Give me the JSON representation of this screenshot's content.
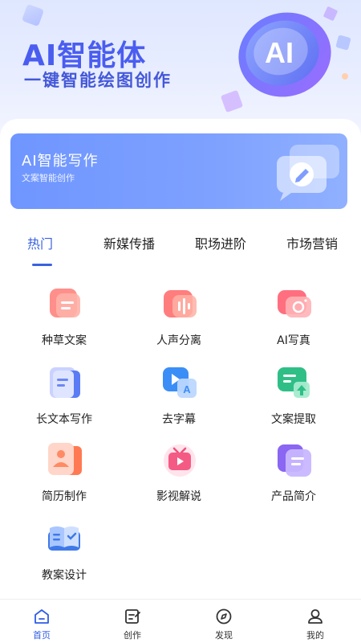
{
  "hero": {
    "title": "AI智能体",
    "subtitle": "一键智能绘图创作",
    "logo_text": "AI"
  },
  "banner": {
    "title": "AI智能写作",
    "subtitle": "文案智能创作",
    "icon": "edit-chat-bubble-icon"
  },
  "tabs": [
    {
      "label": "热门",
      "active": true
    },
    {
      "label": "新媒传播",
      "active": false
    },
    {
      "label": "职场进阶",
      "active": false
    },
    {
      "label": "市场营销",
      "active": false
    }
  ],
  "tools": [
    {
      "label": "种草文案",
      "icon": "note-card-icon"
    },
    {
      "label": "人声分离",
      "icon": "audio-wave-icon"
    },
    {
      "label": "AI写真",
      "icon": "camera-icon"
    },
    {
      "label": "长文本写作",
      "icon": "long-document-icon"
    },
    {
      "label": "去字幕",
      "icon": "subtitle-remove-icon"
    },
    {
      "label": "文案提取",
      "icon": "text-extract-icon"
    },
    {
      "label": "简历制作",
      "icon": "resume-icon"
    },
    {
      "label": "影视解说",
      "icon": "tv-play-icon"
    },
    {
      "label": "产品简介",
      "icon": "product-doc-icon"
    },
    {
      "label": "教案设计",
      "icon": "open-book-icon"
    }
  ],
  "bottom_nav": [
    {
      "label": "首页",
      "icon": "home-icon",
      "active": true
    },
    {
      "label": "创作",
      "icon": "create-icon",
      "active": false
    },
    {
      "label": "发现",
      "icon": "compass-icon",
      "active": false
    },
    {
      "label": "我的",
      "icon": "user-icon",
      "active": false
    }
  ],
  "colors": {
    "accent": "#3a62e0",
    "hero_title": "#4a5df0",
    "banner": "#7a9cff"
  }
}
